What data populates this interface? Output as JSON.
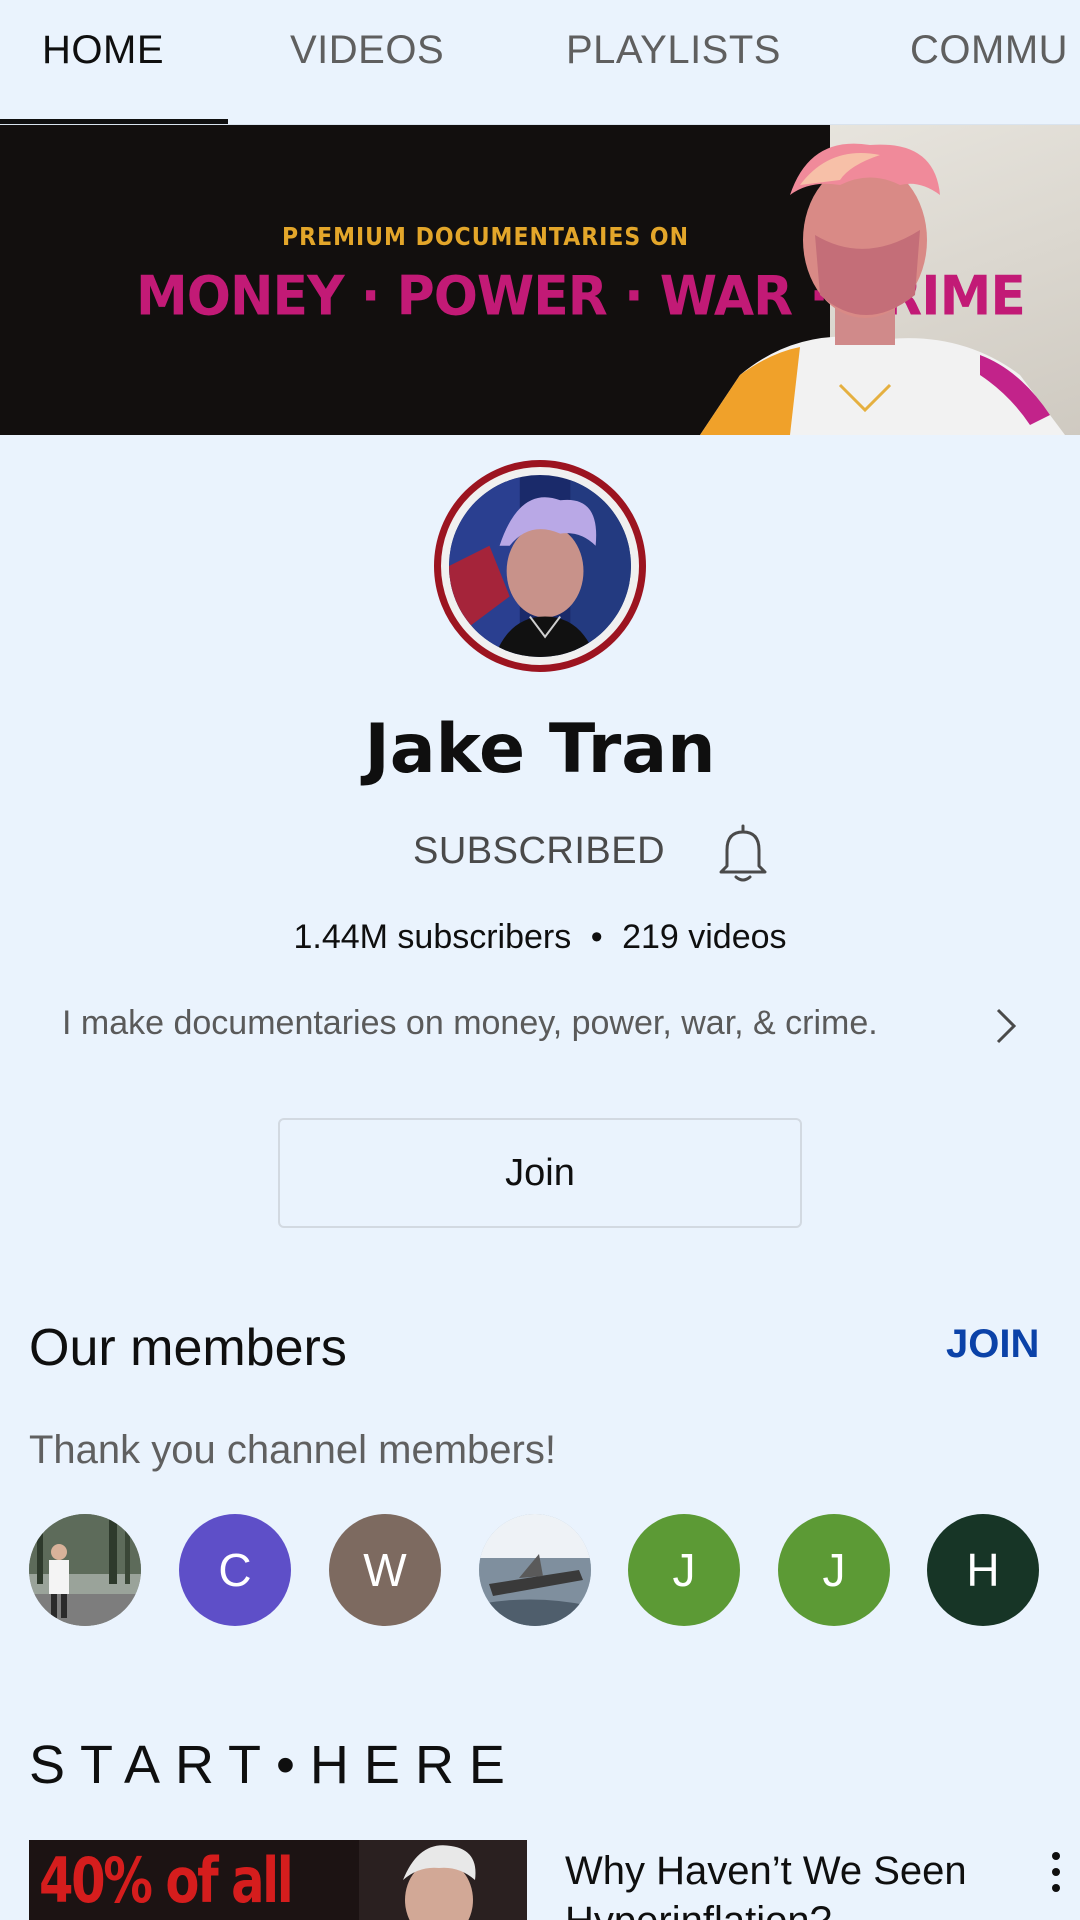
{
  "tabs": [
    {
      "label": "HOME"
    },
    {
      "label": "VIDEOS"
    },
    {
      "label": "PLAYLISTS"
    },
    {
      "label": "COMMU"
    }
  ],
  "banner": {
    "subtitle": "PREMIUM DOCUMENTARIES ON",
    "title": "MONEY · POWER · WAR · CRIME",
    "colors": {
      "subtitle": "#e3a62a",
      "title": "#c21a76"
    }
  },
  "channel": {
    "name": "Jake Tran",
    "subscribe_label": "SUBSCRIBED",
    "subscribers": "1.44M subscribers",
    "separator": "•",
    "videos": "219 videos",
    "description": "I make documentaries on money, power, war, & crime.",
    "join_label": "Join"
  },
  "members": {
    "title": "Our members",
    "join_label": "JOIN",
    "subtitle": "Thank you channel members!",
    "avatars": [
      {
        "type": "photo",
        "icon": "person-photo"
      },
      {
        "type": "letter",
        "letter": "C",
        "color": "#5e4fc8"
      },
      {
        "type": "letter",
        "letter": "W",
        "color": "#7d6a60"
      },
      {
        "type": "photo",
        "icon": "boat-photo"
      },
      {
        "type": "letter",
        "letter": "J",
        "color": "#5c9a35"
      },
      {
        "type": "letter",
        "letter": "J",
        "color": "#5c9a35"
      },
      {
        "type": "letter",
        "letter": "H",
        "color": "#173526"
      }
    ]
  },
  "section": {
    "title": "START•HERE"
  },
  "video": {
    "thumb_text": "40% of all",
    "title": "Why Haven’t We Seen Hyperinflation?"
  },
  "colors": {
    "accent": "#0b42a8",
    "avatar_ring": "#9c1420",
    "background": "#eaf3fd"
  }
}
